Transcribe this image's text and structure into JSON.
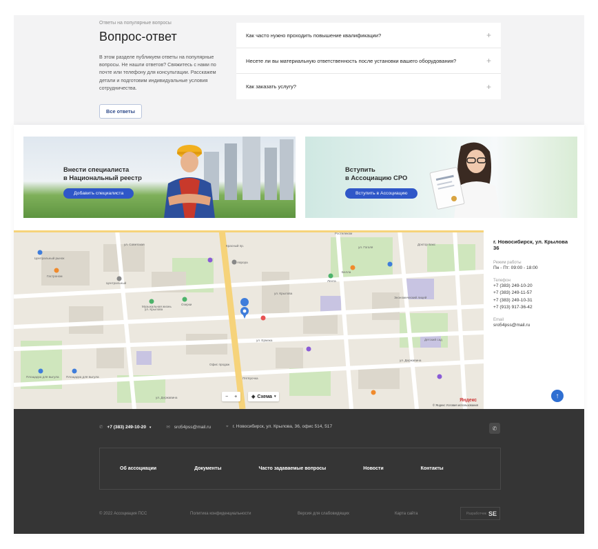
{
  "faq": {
    "breadcrumb": "Ответы на популярные вопросы",
    "title": "Вопрос-ответ",
    "description": "В этом разделе публикуем ответы на популярные вопросы. Не нашли ответов? Свяжитесь с нами по почте или телефону для консультации. Расскажем детали и подготовим индивидуальные условия сотрудничества.",
    "all_button": "Все ответы",
    "items": [
      {
        "question": "Как часто нужно проходить повышение квалификации?"
      },
      {
        "question": "Несете ли вы материальную ответственность после установки вашего оборудования?"
      },
      {
        "question": "Как заказать услугу?"
      }
    ],
    "expand_symbol": "+"
  },
  "banners": [
    {
      "title_line1": "Внести специалиста",
      "title_line2": "в Национальный реестр",
      "button": "Добавить специалиста"
    },
    {
      "title_line1": "Вступить",
      "title_line2": "в Ассоциацию СРО",
      "button": "Вступить в Ассоциацию"
    }
  ],
  "map": {
    "zoom_out": "−",
    "zoom_in": "+",
    "layer_button": "Схема",
    "copyright": "© Яндекс Условия использования",
    "logo": "Яндекс",
    "street_labels": [
      "ул. Крылова",
      "ул. Крылова",
      "ул. Ермака",
      "ул. Державина",
      "ул. Державина",
      "Красный пр.",
      "ул. Гоголя",
      "ул. Советская"
    ],
    "poi_labels": [
      "Центральный рынок",
      "Гастроном",
      "Центральный",
      "Музыкальная жизнь",
      "Озерки",
      "Лента",
      "Пятёрочка",
      "Офис продаж",
      "Аврора",
      "Белла",
      "Экономический лицей",
      "Детский сад",
      "Площадка для выгула",
      "Площадка для выгула",
      "Доктор Бакс",
      "Ростелеком"
    ],
    "accent_color": "#2f6fd2"
  },
  "contact_panel": {
    "address": "г. Новосибирск, ул. Крылова 36",
    "hours_label": "Режим работы",
    "hours": "Пн - Пт: 09:00 - 18:00",
    "phone_label": "Телефон",
    "phones": [
      "+7 (383) 249-10-20",
      "+7 (383) 249-11-57",
      "+7 (383) 249-10-31",
      "+7 (913) 917-36-42"
    ],
    "email_label": "Email",
    "email": "sro54pss@mail.ru",
    "scroll_top_icon": "↑"
  },
  "footer": {
    "phone": "+7 (383) 249-10-20",
    "phone_caret": "▾",
    "email": "sro54pss@mail.ru",
    "address": "г. Новосибирск, ул. Крылова, 36, офис 514, 517",
    "nav": [
      "Об ассоциации",
      "Документы",
      "Часто задаваемые вопросы",
      "Новости",
      "Контакты"
    ],
    "copyright": "© 2022 Ассоциация ПСС",
    "privacy": "Политика конфиденциальности",
    "accessible": "Версия для слабовидящих",
    "sitemap": "Карта сайта",
    "developer_label": "Разработчик",
    "developer_logo": "SE"
  },
  "colors": {
    "primary_button": "#2f57c8",
    "footer_bg": "#353535",
    "faq_bg": "#f3f3f4"
  }
}
